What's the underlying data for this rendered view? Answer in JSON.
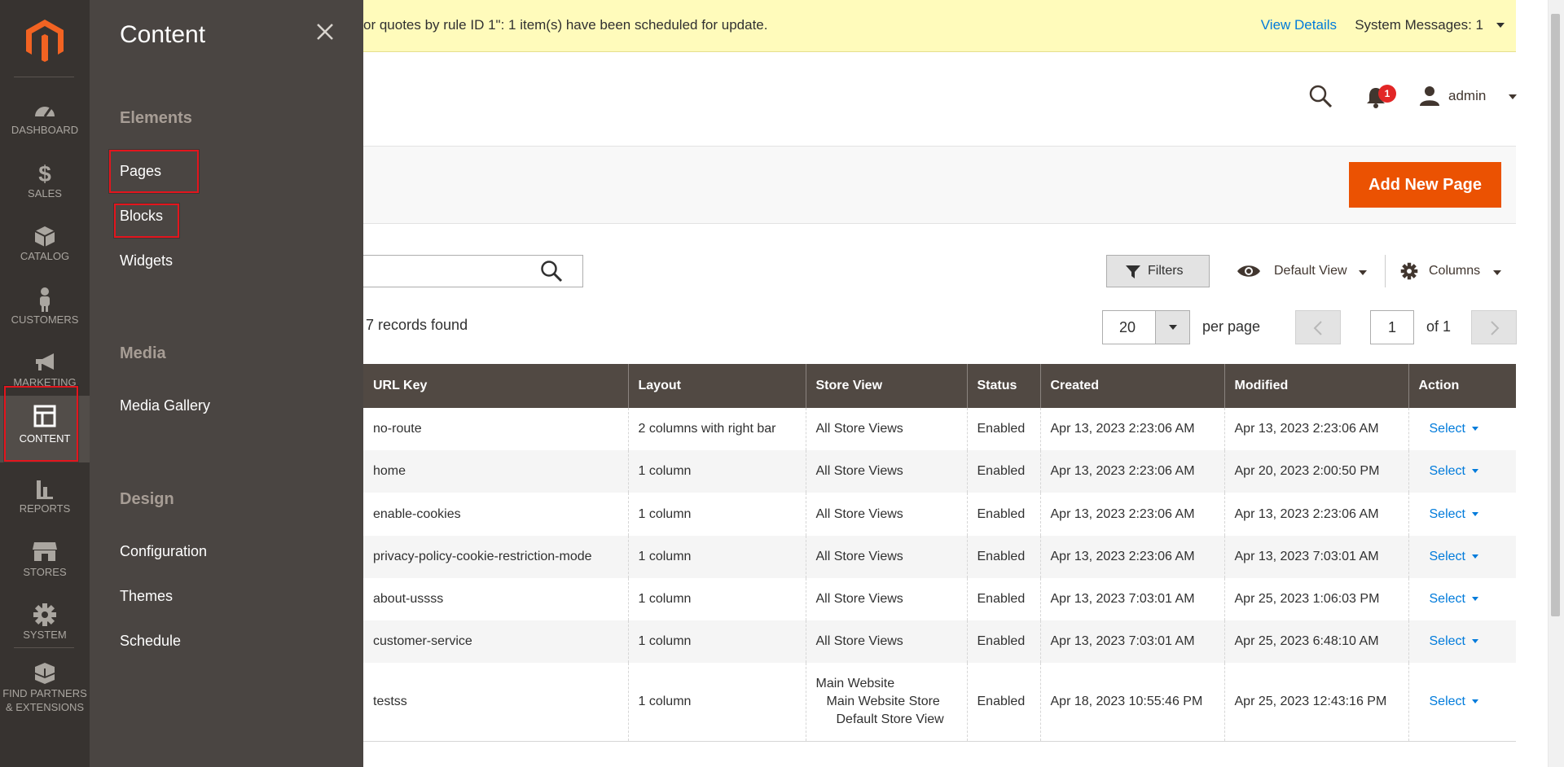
{
  "nav": {
    "items": [
      {
        "label": "DASHBOARD",
        "icon": "speedometer-icon"
      },
      {
        "label": "SALES",
        "icon": "dollar-icon"
      },
      {
        "label": "CATALOG",
        "icon": "cube-icon"
      },
      {
        "label": "CUSTOMERS",
        "icon": "person-icon"
      },
      {
        "label": "MARKETING",
        "icon": "megaphone-icon"
      },
      {
        "label": "CONTENT",
        "icon": "layout-icon"
      },
      {
        "label": "REPORTS",
        "icon": "bar-chart-icon"
      },
      {
        "label": "STORES",
        "icon": "storefront-icon"
      },
      {
        "label": "SYSTEM",
        "icon": "gear-icon"
      }
    ],
    "partners_line1": "FIND PARTNERS",
    "partners_line2": "& EXTENSIONS"
  },
  "flyout": {
    "title": "Content",
    "groups": {
      "elements": {
        "title": "Elements",
        "links": [
          "Pages",
          "Blocks",
          "Widgets"
        ]
      },
      "media": {
        "title": "Media",
        "links": [
          "Media Gallery"
        ]
      },
      "design": {
        "title": "Design",
        "links": [
          "Configuration",
          "Themes",
          "Schedule"
        ]
      }
    }
  },
  "system_message": {
    "text": "or quotes by rule ID 1\": 1 item(s) have been scheduled for update.",
    "view_details": "View Details",
    "count_label": "System Messages: 1"
  },
  "header": {
    "notification_count": "1",
    "username": "admin"
  },
  "actions": {
    "add_new_page": "Add New Page"
  },
  "grid_toolbar": {
    "search_placeholder": "",
    "records_found": "7 records found",
    "filters": "Filters",
    "default_view": "Default View",
    "columns": "Columns",
    "per_page_value": "20",
    "per_page_label": "per page",
    "current_page": "1",
    "of_pages": "of 1"
  },
  "grid": {
    "columns": [
      "URL Key",
      "Layout",
      "Store View",
      "Status",
      "Created",
      "Modified",
      "Action"
    ],
    "action_label": "Select",
    "rows": [
      {
        "url_key": "no-route",
        "layout": "2 columns with right bar",
        "store_view": [
          "All Store Views"
        ],
        "status": "Enabled",
        "created": "Apr 13, 2023 2:23:06 AM",
        "modified": "Apr 13, 2023 2:23:06 AM"
      },
      {
        "url_key": "home",
        "layout": "1 column",
        "store_view": [
          "All Store Views"
        ],
        "status": "Enabled",
        "created": "Apr 13, 2023 2:23:06 AM",
        "modified": "Apr 20, 2023 2:00:50 PM"
      },
      {
        "url_key": "enable-cookies",
        "layout": "1 column",
        "store_view": [
          "All Store Views"
        ],
        "status": "Enabled",
        "created": "Apr 13, 2023 2:23:06 AM",
        "modified": "Apr 13, 2023 2:23:06 AM"
      },
      {
        "url_key": "privacy-policy-cookie-restriction-mode",
        "layout": "1 column",
        "store_view": [
          "All Store Views"
        ],
        "status": "Enabled",
        "created": "Apr 13, 2023 2:23:06 AM",
        "modified": "Apr 13, 2023 7:03:01 AM"
      },
      {
        "url_key": "about-ussss",
        "layout": "1 column",
        "store_view": [
          "All Store Views"
        ],
        "status": "Enabled",
        "created": "Apr 13, 2023 7:03:01 AM",
        "modified": "Apr 25, 2023 1:06:03 PM"
      },
      {
        "url_key": "customer-service",
        "layout": "1 column",
        "store_view": [
          "All Store Views"
        ],
        "status": "Enabled",
        "created": "Apr 13, 2023 7:03:01 AM",
        "modified": "Apr 25, 2023 6:48:10 AM"
      },
      {
        "url_key": "testss",
        "layout": "1 column",
        "store_view": [
          "Main Website",
          "Main Website Store",
          "Default Store View"
        ],
        "status": "Enabled",
        "created": "Apr 18, 2023 10:55:46 PM",
        "modified": "Apr 25, 2023 12:43:16 PM"
      }
    ]
  },
  "colors": {
    "nav_bg": "#373330",
    "flyout_bg": "#4a4542",
    "accent_orange": "#eb5202",
    "link_blue": "#007bdb",
    "highlight_red": "#e3151d",
    "message_bg": "#fffbbb",
    "grid_header_bg": "#514943"
  }
}
